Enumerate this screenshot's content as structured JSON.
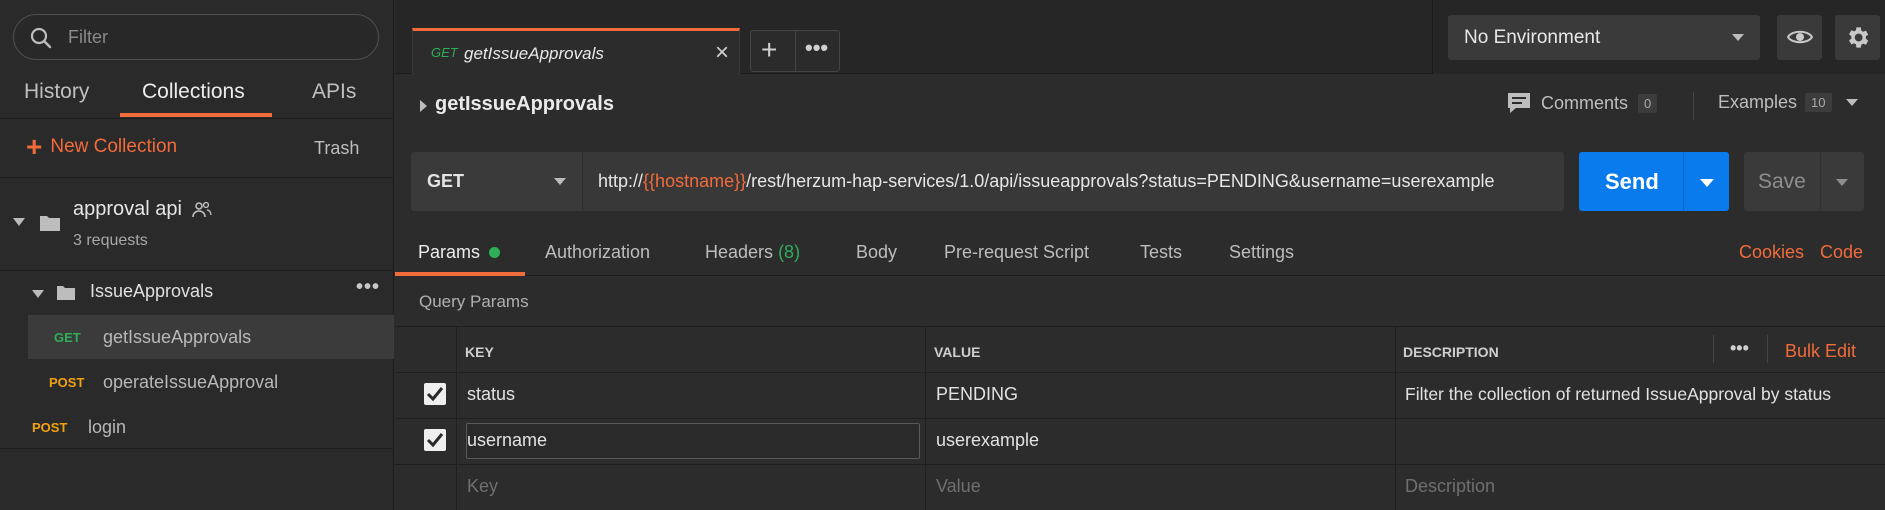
{
  "sidebar": {
    "filter_placeholder": "Filter",
    "tabs": [
      {
        "label": "History"
      },
      {
        "label": "Collections"
      },
      {
        "label": "APIs"
      }
    ],
    "new_collection_label": "New Collection",
    "trash_label": "Trash",
    "collection": {
      "name": "approval api",
      "count": "3 requests",
      "folder": {
        "name": "IssueApprovals",
        "requests": [
          {
            "method": "GET",
            "name": "getIssueApprovals"
          },
          {
            "method": "POST",
            "name": "operateIssueApproval"
          }
        ]
      },
      "requests": [
        {
          "method": "POST",
          "name": "login"
        }
      ]
    }
  },
  "tabs": {
    "active": {
      "method": "GET",
      "name": "getIssueApprovals"
    }
  },
  "environment": {
    "selected": "No Environment"
  },
  "request": {
    "title": "getIssueApprovals",
    "comments_label": "Comments",
    "comments_count": "0",
    "examples_label": "Examples",
    "examples_count": "10",
    "method": "GET",
    "url_prefix": "http://",
    "url_variable": "{{hostname}}",
    "url_suffix": "/rest/herzum-hap-services/1.0/api/issueapprovals?status=PENDING&username=userexample",
    "send_label": "Send",
    "save_label": "Save"
  },
  "request_tabs": {
    "params": "Params",
    "authorization": "Authorization",
    "headers": "Headers",
    "headers_count": "(8)",
    "body": "Body",
    "prerequest": "Pre-request Script",
    "tests": "Tests",
    "settings": "Settings",
    "cookies": "Cookies",
    "code": "Code"
  },
  "params": {
    "title": "Query Params",
    "columns": {
      "key": "KEY",
      "value": "VALUE",
      "description": "DESCRIPTION"
    },
    "bulk_edit": "Bulk Edit",
    "rows": [
      {
        "checked": true,
        "key": "status",
        "value": "PENDING",
        "description": "Filter the collection of returned IssueApproval by status"
      },
      {
        "checked": true,
        "key": "username",
        "value": "userexample",
        "description": ""
      }
    ],
    "placeholders": {
      "key": "Key",
      "value": "Value",
      "description": "Description"
    }
  },
  "colors": {
    "accent": "#f26b3a",
    "send": "#097bed",
    "get": "#2fae57",
    "post": "#f1a20f"
  }
}
